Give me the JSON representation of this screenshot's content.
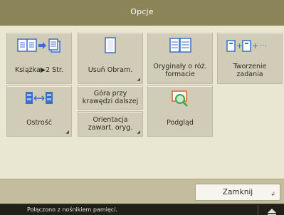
{
  "window": {
    "title": "Opcje"
  },
  "tiles": [
    {
      "label": "Książka▶2 Str.",
      "icon": "book-to-two-pages-icon"
    },
    {
      "label": "Usuń Obram.",
      "icon": "erase-frame-icon"
    },
    {
      "label": "Oryginały o róż. formacie",
      "icon": "different-size-originals-icon"
    },
    {
      "label": "Tworzenie zadania",
      "icon": "job-build-icon"
    },
    {
      "label": "Ostrość",
      "icon": "sharpness-icon"
    },
    {
      "label": "Góra przy krawędzi dalszej",
      "icon": ""
    },
    {
      "label": "Orientacja zawart. oryg.",
      "icon": ""
    },
    {
      "label": "Podgląd",
      "icon": "preview-icon"
    }
  ],
  "footer": {
    "close_label": "Zamknij"
  },
  "status": {
    "message": "Połączono z nośnikiem pamięci.",
    "eject_icon": "eject-icon"
  },
  "colors": {
    "title_bar": "#8a8458",
    "panel": "#e9e6d2",
    "tile": "#d0ccb8",
    "status_bar": "#202019",
    "icon_blue": "#3b6fc9",
    "icon_green": "#3aa24b"
  }
}
